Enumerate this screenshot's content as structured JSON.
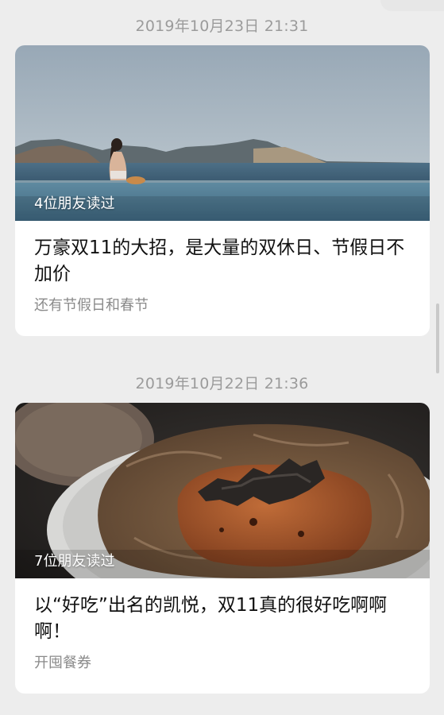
{
  "feed": {
    "articles": [
      {
        "timestamp": "2019年10月23日  21:31",
        "read_badge": "4位朋友读过",
        "title": "万豪双11的大招，是大量的双休日、节假日不加价",
        "subtitle": "还有节假日和春节",
        "image": "infinity-pool-sea-photo"
      },
      {
        "timestamp": "2019年10月22日  21:36",
        "read_badge": "7位朋友读过",
        "title": "以“好吃”出名的凯悦，双11真的很好吃啊啊啊！",
        "subtitle": "开囤餐券",
        "image": "lotus-leaf-dish-photo"
      }
    ]
  },
  "colors": {
    "background": "#ededed",
    "card": "#ffffff",
    "timestamp": "#9b9b9b",
    "title": "#111111",
    "subtitle": "#8a8a8a"
  }
}
